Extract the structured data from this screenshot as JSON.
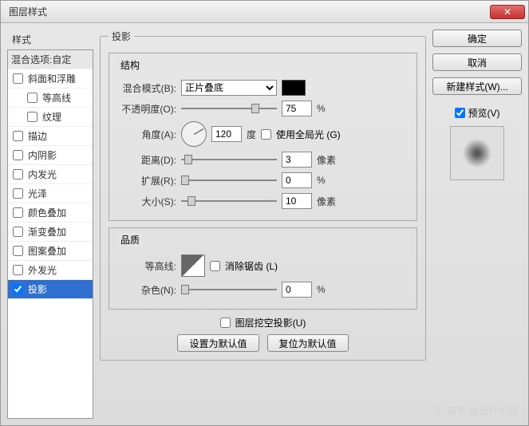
{
  "titlebar": {
    "title": "图层样式",
    "close": "✕"
  },
  "left": {
    "title": "样式",
    "header": "混合选项:自定",
    "items": [
      {
        "label": "斜面和浮雕",
        "checked": false,
        "indent": 0
      },
      {
        "label": "等高线",
        "checked": false,
        "indent": 1
      },
      {
        "label": "纹理",
        "checked": false,
        "indent": 1
      },
      {
        "label": "描边",
        "checked": false,
        "indent": 0
      },
      {
        "label": "内阴影",
        "checked": false,
        "indent": 0
      },
      {
        "label": "内发光",
        "checked": false,
        "indent": 0
      },
      {
        "label": "光泽",
        "checked": false,
        "indent": 0
      },
      {
        "label": "颜色叠加",
        "checked": false,
        "indent": 0
      },
      {
        "label": "渐变叠加",
        "checked": false,
        "indent": 0
      },
      {
        "label": "图案叠加",
        "checked": false,
        "indent": 0
      },
      {
        "label": "外发光",
        "checked": false,
        "indent": 0
      },
      {
        "label": "投影",
        "checked": true,
        "indent": 0,
        "selected": true
      }
    ]
  },
  "center": {
    "section_title": "投影",
    "structure": {
      "legend": "结构",
      "blend_mode_label": "混合模式(B):",
      "blend_mode_value": "正片叠底",
      "opacity_label": "不透明度(O):",
      "opacity_value": "75",
      "opacity_unit": "%",
      "angle_label": "角度(A):",
      "angle_value": "120",
      "angle_unit": "度",
      "use_global_label": "使用全局光 (G)",
      "distance_label": "距离(D):",
      "distance_value": "3",
      "distance_unit": "像素",
      "spread_label": "扩展(R):",
      "spread_value": "0",
      "spread_unit": "%",
      "size_label": "大小(S):",
      "size_value": "10",
      "size_unit": "像素"
    },
    "quality": {
      "legend": "品质",
      "contour_label": "等高线:",
      "antialias_label": "消除锯齿 (L)",
      "noise_label": "杂色(N):",
      "noise_value": "0",
      "noise_unit": "%"
    },
    "knockout_label": "图层挖空投影(U)",
    "set_default": "设置为默认值",
    "reset_default": "复位为默认值"
  },
  "right": {
    "ok": "确定",
    "cancel": "取消",
    "new_style": "新建样式(W)...",
    "preview_label": "预览(V)"
  },
  "watermark": "知乎 @设计小白"
}
